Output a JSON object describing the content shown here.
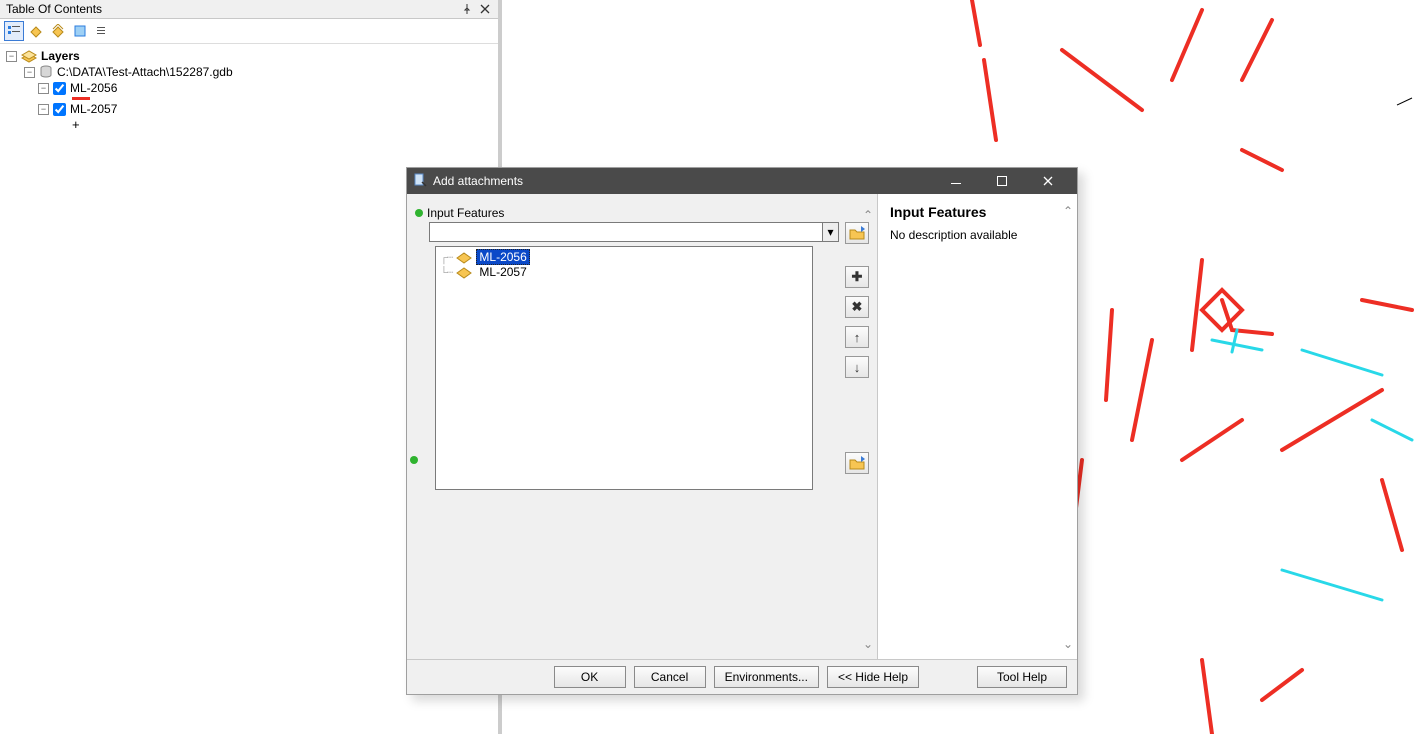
{
  "toc": {
    "title": "Table Of Contents",
    "root": "Layers",
    "gdb_path": "C:\\DATA\\Test-Attach\\152287.gdb",
    "layers": [
      {
        "name": "ML-2056",
        "checked": true,
        "symbol": "red-line"
      },
      {
        "name": "ML-2057",
        "checked": true,
        "symbol": "cross"
      }
    ]
  },
  "dialog": {
    "title": "Add attachments",
    "section_label": "Input Features",
    "combo_value": "",
    "options": [
      {
        "label": "ML-2056",
        "selected": true
      },
      {
        "label": "ML-2057",
        "selected": false
      }
    ],
    "buttons": {
      "ok": "OK",
      "cancel": "Cancel",
      "env": "Environments...",
      "hide_help": "<< Hide Help",
      "tool_help": "Tool Help"
    },
    "help": {
      "heading": "Input Features",
      "body": "No description available"
    }
  }
}
